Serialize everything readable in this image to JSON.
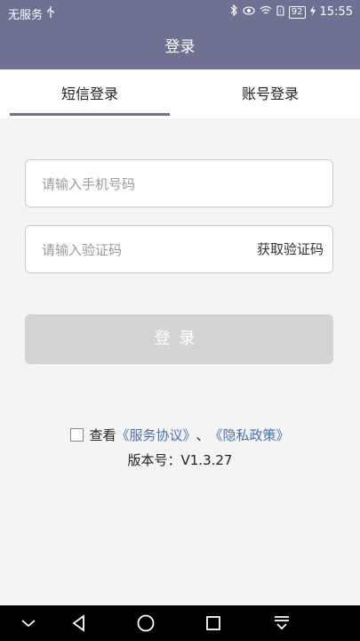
{
  "status_bar": {
    "carrier": "无服务",
    "battery": "92",
    "time": "15:55"
  },
  "header": {
    "title": "登录"
  },
  "tabs": [
    {
      "label": "短信登录",
      "active": true
    },
    {
      "label": "账号登录",
      "active": false
    }
  ],
  "form": {
    "phone_placeholder": "请输入手机号码",
    "code_placeholder": "请输入验证码",
    "get_code_label": "获取验证码",
    "login_label": "登录"
  },
  "agreement": {
    "prefix": "查看",
    "service_link": "《服务协议》",
    "separator": "、",
    "privacy_link": "《隐私政策》",
    "checked": false
  },
  "version": {
    "text": "版本号：V1.3.27"
  },
  "colors": {
    "primary": "#6e7191",
    "link": "#4a6fb0",
    "disabled_button": "#d4d4d4",
    "background": "#f4f4f4"
  },
  "icons": {
    "status": [
      "usb-icon",
      "bluetooth-icon",
      "eye-icon",
      "wifi-icon",
      "sim-icon",
      "battery-icon",
      "charging-icon"
    ],
    "nav": [
      "chevron-down-icon",
      "back-triangle-icon",
      "home-circle-icon",
      "recents-square-icon",
      "notification-pull-icon"
    ]
  }
}
